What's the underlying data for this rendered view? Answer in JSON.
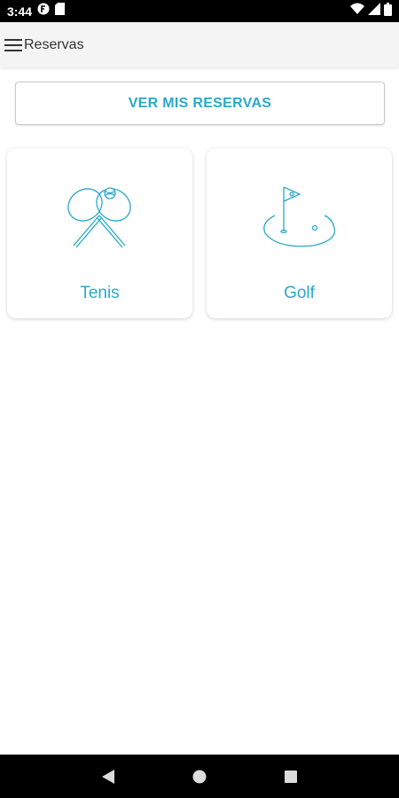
{
  "status_bar": {
    "time": "3:44",
    "left_icons": [
      "f-notification-icon",
      "sd-card-icon"
    ],
    "right_icons": [
      "wifi-icon",
      "cell-signal-icon",
      "battery-icon"
    ]
  },
  "app_bar": {
    "menu_icon": "hamburger-menu-icon",
    "title": "Reservas"
  },
  "main": {
    "ver_button_label": "VER MIS RESERVAS",
    "cards": [
      {
        "label": "Tenis",
        "icon": "tennis-rackets-icon"
      },
      {
        "label": "Golf",
        "icon": "golf-flag-icon"
      }
    ]
  },
  "nav_bar": {
    "buttons": [
      "back-icon",
      "home-icon",
      "recents-icon"
    ]
  },
  "colors": {
    "accent": "#29a9c8",
    "status_bar": "#000000",
    "app_bar": "#f4f4f4",
    "background": "#ffffff"
  }
}
